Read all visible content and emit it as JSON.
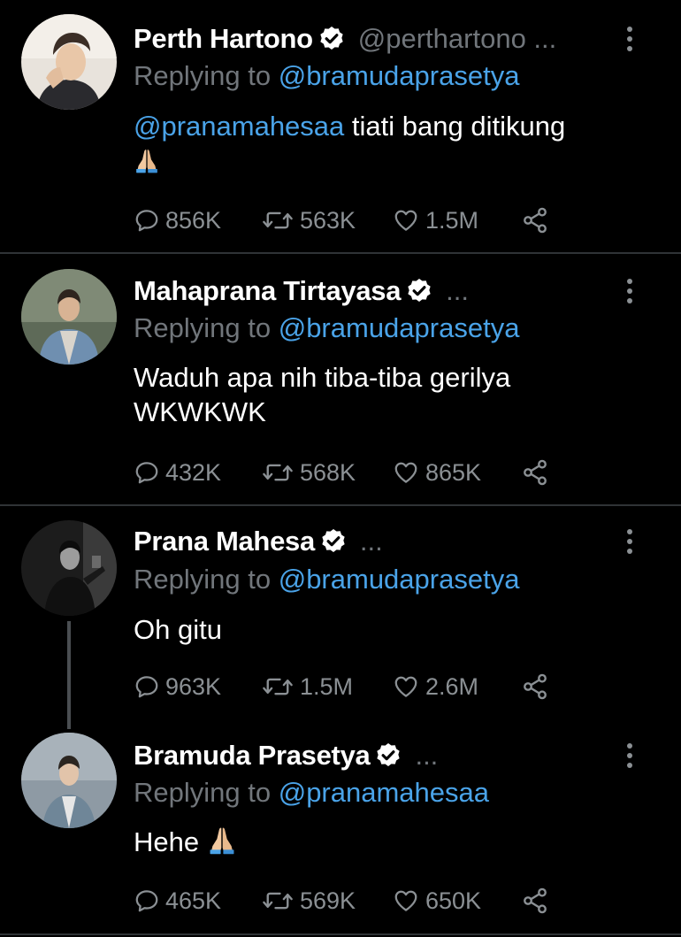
{
  "replying_prefix": "Replying to",
  "tweets": [
    {
      "name": "Perth Hartono",
      "handle": "@perthartono ...",
      "replying_to": "@bramudaprasetya",
      "mention": "@pranamahesaa",
      "text": " tiati bang ditikung",
      "emoji": "folded-hands",
      "replies": "856K",
      "retweets": "563K",
      "likes": "1.5M"
    },
    {
      "name": "Mahaprana Tirtayasa",
      "handle": "...",
      "replying_to": "@bramudaprasetya",
      "text": "Waduh apa nih tiba-tiba gerilya WKWKWK",
      "replies": "432K",
      "retweets": "568K",
      "likes": "865K"
    },
    {
      "name": "Prana Mahesa",
      "handle": "...",
      "replying_to": "@bramudaprasetya",
      "text": "Oh gitu",
      "replies": "963K",
      "retweets": "1.5M",
      "likes": "2.6M"
    },
    {
      "name": "Bramuda Prasetya",
      "handle": "...",
      "replying_to": "@pranamahesaa",
      "text": "Hehe ",
      "emoji": "folded-hands",
      "replies": "465K",
      "retweets": "569K",
      "likes": "650K"
    }
  ],
  "icons": {
    "reply": "reply-icon",
    "retweet": "retweet-icon",
    "like": "heart-icon",
    "share": "share-icon",
    "verified": "verified-badge-icon",
    "more": "more-options-icon"
  },
  "colors": {
    "background": "#000000",
    "link": "#4aa3e8",
    "muted": "#71767b",
    "divider": "#2f3336"
  }
}
